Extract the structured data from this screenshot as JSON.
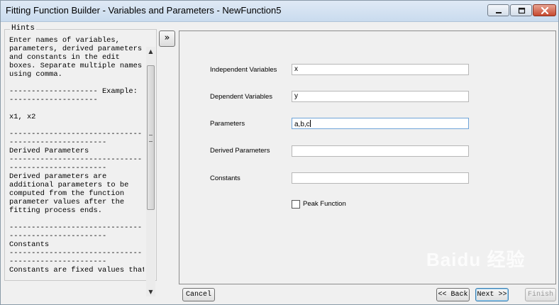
{
  "window": {
    "title": "Fitting Function Builder - Variables and Parameters - NewFunction5"
  },
  "hints": {
    "legend": "Hints",
    "text": "Enter names of variables,\nparameters, derived parameters\nand constants in the edit\nboxes. Separate multiple names\nusing comma.\n\n-------------------- Example:\n--------------------\n\nx1, x2\n\n------------------------------\n----------------------\nDerived Parameters\n------------------------------\n----------------------\nDerived parameters are\nadditional parameters to be\ncomputed from the function\nparameter values after the\nfitting process ends.\n\n------------------------------\n----------------------\nConstants\n------------------------------\n----------------------\nConstants are fixed values that"
  },
  "expand_button": {
    "label": "»"
  },
  "form": {
    "fields": [
      {
        "label": "Independent Variables",
        "value": "x"
      },
      {
        "label": "Dependent Variables",
        "value": "y"
      },
      {
        "label": "Parameters",
        "value": "a,b,c"
      },
      {
        "label": "Derived Parameters",
        "value": ""
      },
      {
        "label": "Constants",
        "value": ""
      }
    ],
    "peak_function": {
      "label": "Peak Function",
      "checked": false
    }
  },
  "buttons": {
    "cancel": "Cancel",
    "back": "<< Back",
    "next": "Next >>",
    "finish": "Finish"
  },
  "watermark": "Baidu 经验",
  "colors": {
    "title_gradient_top": "#dfe9f5",
    "close_button": "#c6492f",
    "active_field_border": "#6fa4d8"
  }
}
